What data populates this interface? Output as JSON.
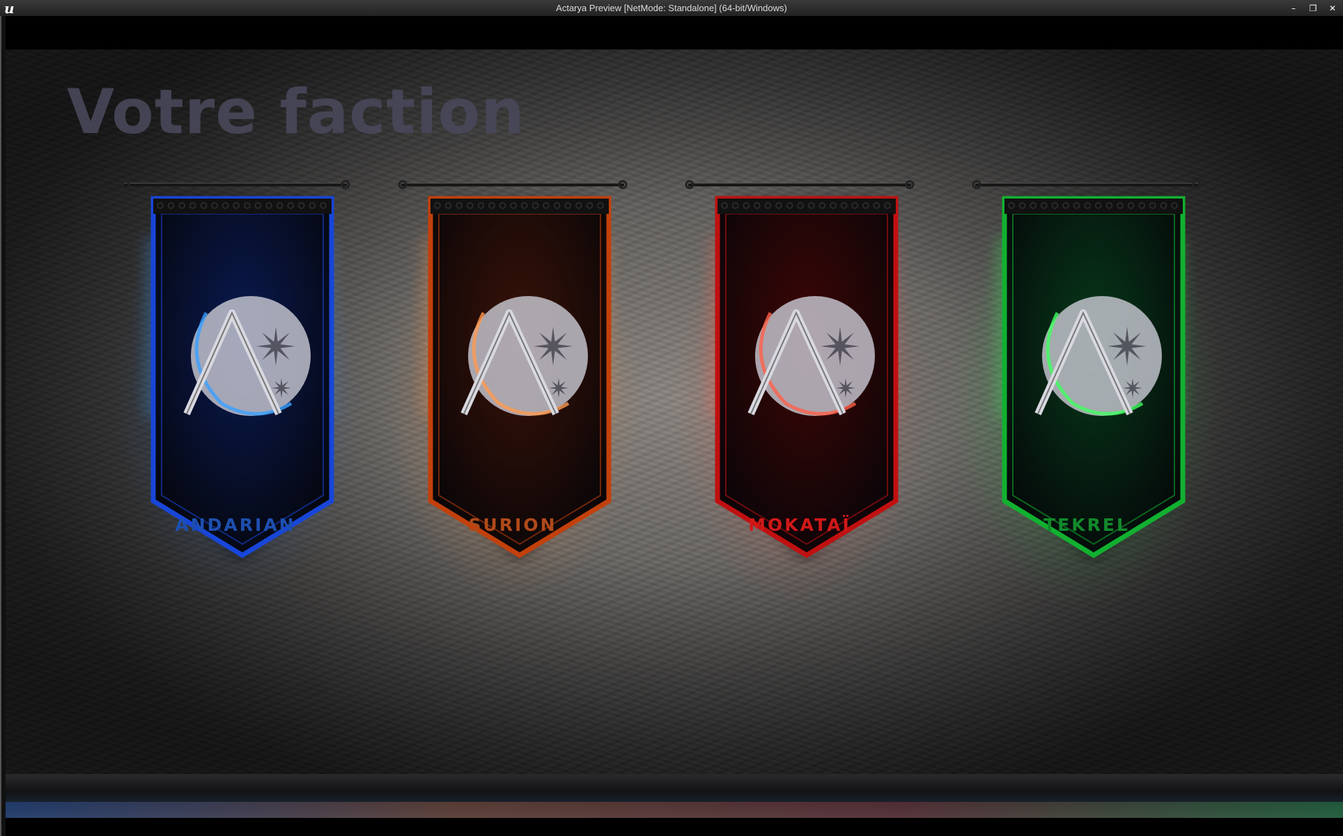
{
  "window": {
    "title": "Actarya Preview [NetMode: Standalone] (64-bit/Windows)",
    "logo_icon": "unreal-engine-logo-icon",
    "logo_glyph": "u",
    "minimize_glyph": "–",
    "restore_glyph": "❐",
    "close_glyph": "✕"
  },
  "screen": {
    "title": "Votre faction"
  },
  "factions": [
    {
      "name": "ANDARIAN",
      "cloth": "#0a1a52",
      "trim": "#1846d8",
      "glow": "#3aa0ff",
      "text": "#1e4fb0"
    },
    {
      "name": "SURION",
      "cloth": "#3a1208",
      "trim": "#c2400c",
      "glow": "#ff9a50",
      "text": "#b04a1a"
    },
    {
      "name": "MOKATAÏ",
      "cloth": "#3e0606",
      "trim": "#c01010",
      "glow": "#ff6048",
      "text": "#d01818"
    },
    {
      "name": "TEKREL",
      "cloth": "#06381a",
      "trim": "#12b030",
      "glow": "#40ff60",
      "text": "#128a2c"
    }
  ],
  "emblem_icon": "crescent-moon-star-emblem-icon"
}
